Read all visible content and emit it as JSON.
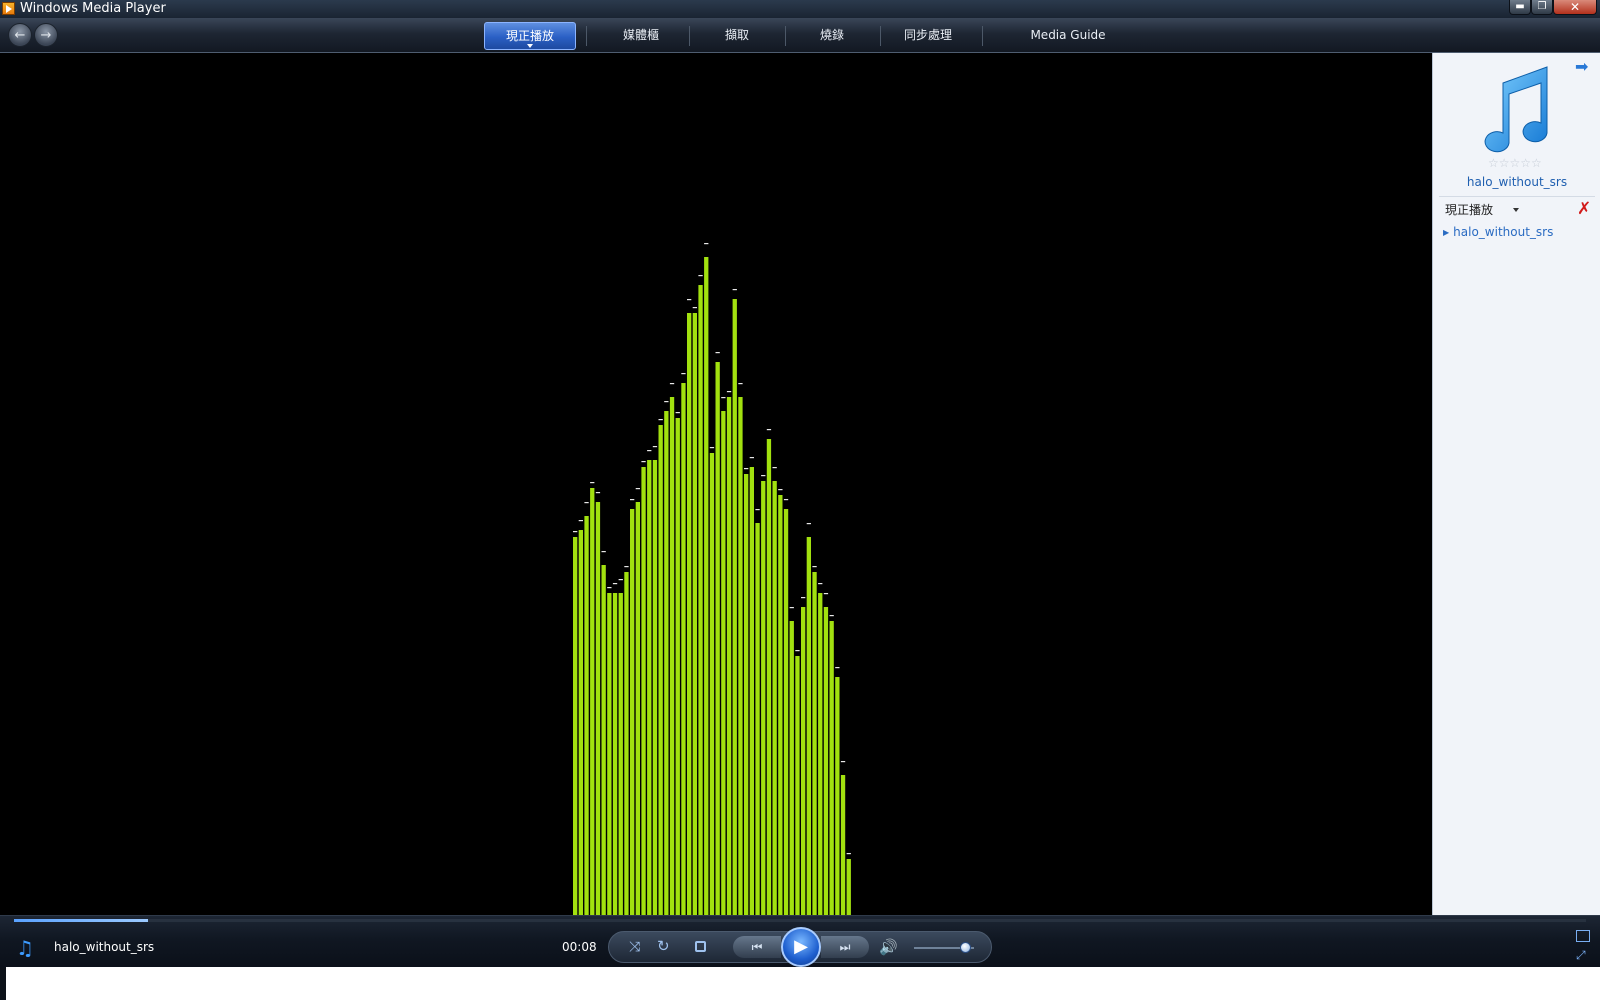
{
  "window": {
    "title": "Windows Media Player"
  },
  "window_controls": {
    "minimize": "▬",
    "maximize": "❐",
    "close": "✕"
  },
  "nav": {
    "back": "←",
    "forward": "→",
    "tabs": [
      {
        "label": "現正播放",
        "active": true
      },
      {
        "label": "媒體櫃",
        "active": false
      },
      {
        "label": "擷取",
        "active": false
      },
      {
        "label": "燒錄",
        "active": false
      },
      {
        "label": "同步處理",
        "active": false
      },
      {
        "label": "Media Guide",
        "active": false
      }
    ]
  },
  "visualization": {
    "bar_color": "#a2e10f",
    "levels": [
      0.54,
      0.55,
      0.57,
      0.61,
      0.59,
      0.5,
      0.46,
      0.46,
      0.46,
      0.49,
      0.58,
      0.59,
      0.64,
      0.65,
      0.65,
      0.7,
      0.72,
      0.74,
      0.71,
      0.76,
      0.86,
      0.86,
      0.9,
      0.94,
      0.66,
      0.79,
      0.72,
      0.74,
      0.88,
      0.74,
      0.63,
      0.64,
      0.56,
      0.62,
      0.68,
      0.62,
      0.6,
      0.58,
      0.42,
      0.37,
      0.44,
      0.54,
      0.49,
      0.46,
      0.44,
      0.42,
      0.34,
      0.2,
      0.08
    ]
  },
  "right_pane": {
    "art_icon": "music-note-icon",
    "rating": "☆☆☆☆☆",
    "track_title": "halo_without_srs",
    "playlist_label": "現正播放",
    "playlist_items": [
      "halo_without_srs"
    ],
    "pane_arrow": "➡",
    "clear_icon": "✗"
  },
  "player": {
    "track_title": "halo_without_srs",
    "elapsed": "00:08",
    "progress": 0.085,
    "volume": 0.85,
    "icons": {
      "shuffle": "⤨",
      "repeat": "↻",
      "prev": "⏮",
      "play": "▶",
      "next": "⏭",
      "mute": "🔊",
      "now_playing": "♫",
      "full_screen": "⤢"
    }
  },
  "colors": {
    "accent": "#2a79d6",
    "viz_bar": "#a2e10f",
    "seek": "#5aa2ff"
  }
}
